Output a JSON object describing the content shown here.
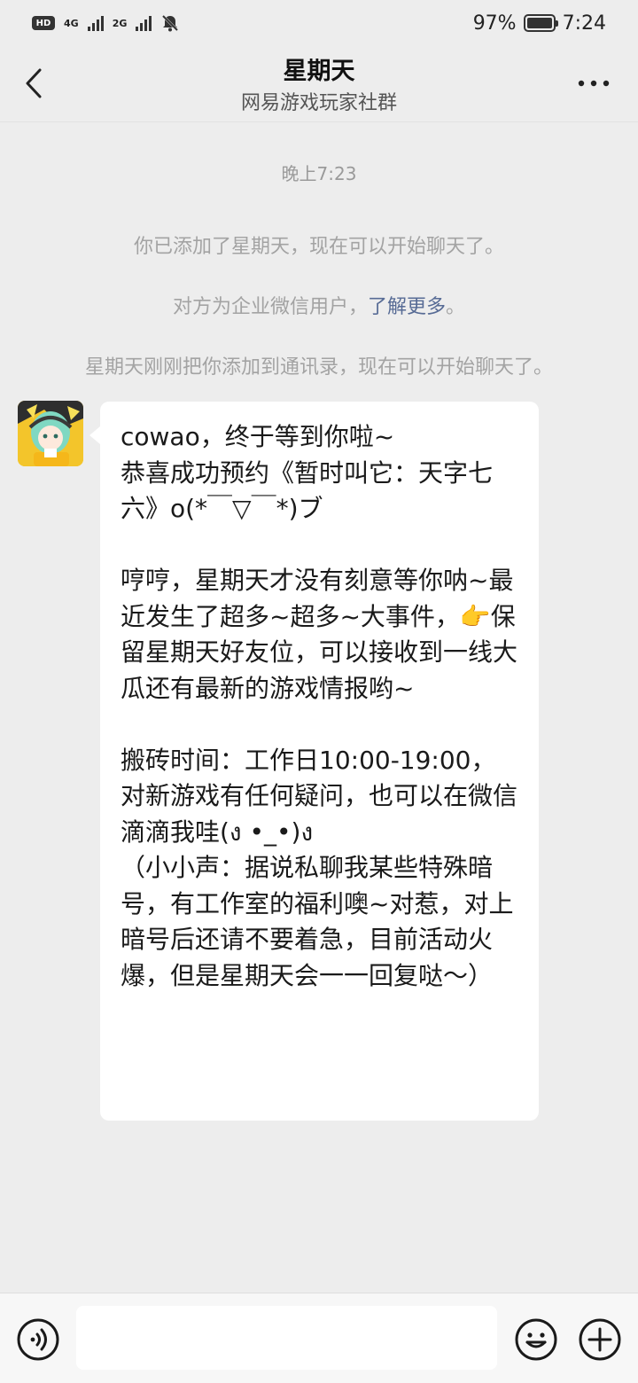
{
  "status_bar": {
    "hd_label": "HD",
    "sim1_label": "4G",
    "sim2_label": "2G",
    "battery_percent": "97%",
    "time": "7:24"
  },
  "header": {
    "title": "星期天",
    "subtitle": "网易游戏玩家社群"
  },
  "chat": {
    "timestamp": "晚上7:23",
    "system_added": "你已添加了星期天，现在可以开始聊天了。",
    "system_enterprise_prefix": "对方为企业微信用户，",
    "system_enterprise_link": "了解更多",
    "system_enterprise_suffix": "。",
    "system_contact": "星期天刚刚把你添加到通讯录，现在可以开始聊天了。",
    "message_text": "cowao，终于等到你啦~\n恭喜成功预约《暂时叫它：天字七六》o(*￣▽￣*)ブ\n\n哼哼，星期天才没有刻意等你呐~最近发生了超多~超多~大事件，👉保留星期天好友位，可以接收到一线大瓜还有最新的游戏情报哟~\n\n搬砖时间：工作日10:00-19:00，对新游戏有任何疑问，也可以在微信滴滴我哇(ง •_•)ง\n（小小声：据说私聊我某些特殊暗号，有工作室的福利噢~对惹，对上暗号后还请不要着急，目前活动火爆，但是星期天会一一回复哒～）"
  },
  "input_bar": {
    "placeholder": "",
    "voice_icon": "voice-icon",
    "emoji_icon": "emoji-icon",
    "plus_icon": "plus-icon"
  },
  "colors": {
    "background": "#ededed",
    "bubble": "#ffffff",
    "link": "#576b95",
    "system_text": "#a3a3a3"
  }
}
